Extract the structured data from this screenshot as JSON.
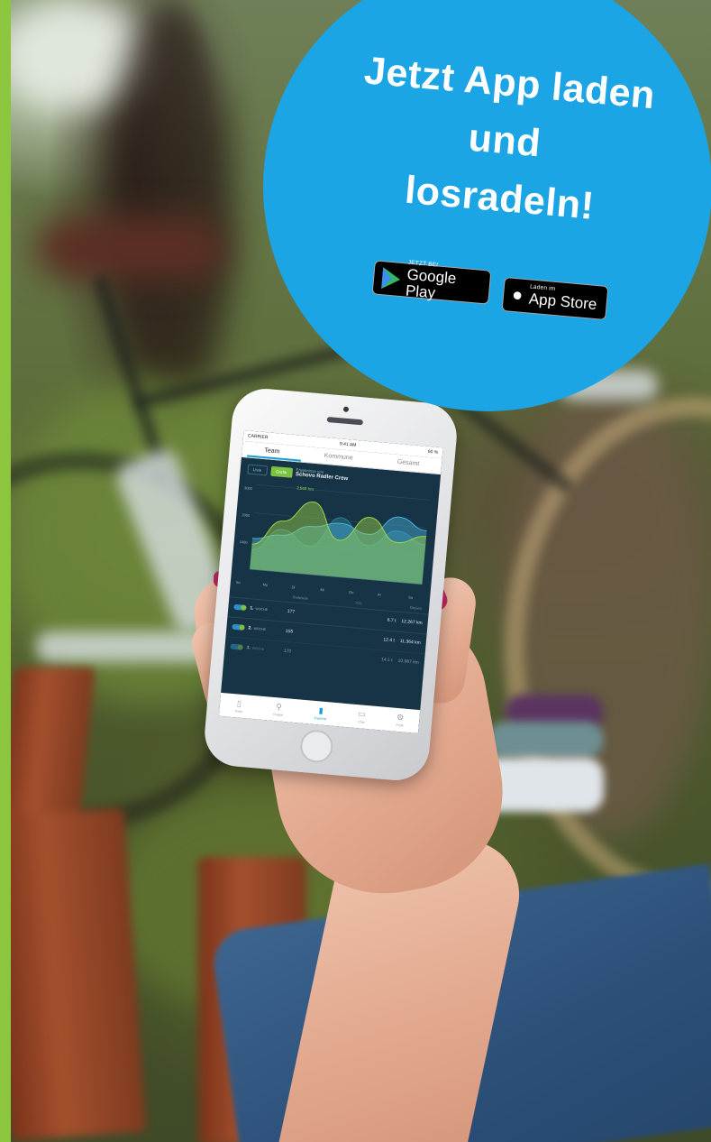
{
  "promo": {
    "headline_line1": "Jetzt App laden",
    "headline_line2": "und",
    "headline_line3": "losradeln!",
    "circle_color": "#1ba5e5",
    "stores": [
      {
        "small": "JETZT BEI",
        "big": "Google Play",
        "icon": "google-play-icon"
      },
      {
        "small": "Laden im",
        "big": "App Store",
        "icon": "apple-icon"
      }
    ]
  },
  "accent_strip_color": "#8cc63f",
  "phone": {
    "status": {
      "carrier": "CARRIER",
      "time": "9:41 AM",
      "battery": "60 %"
    },
    "tabs": [
      "Team",
      "Kommune",
      "Gesamt"
    ],
    "active_tab": "Team",
    "toggle": {
      "list": "Liste",
      "graph": "Grafik"
    },
    "results_caption": "Ergebnisse von",
    "team_name": "Schovo Radler Crew",
    "chart_data": {
      "type": "area",
      "y_unit": "km",
      "ticks_y": [
        "3000",
        "2000",
        "1000"
      ],
      "peak_label": "2.568 km",
      "categories": [
        "So",
        "Mo",
        "Di",
        "Mi",
        "Do",
        "Fr",
        "Sa"
      ],
      "series": [
        {
          "values": [
            900,
            1800,
            2568,
            1300,
            2200,
            1400,
            1700
          ]
        },
        {
          "values": [
            1100,
            1300,
            1700,
            1900,
            1600,
            2300,
            1900
          ]
        },
        {
          "values": [
            700,
            1500,
            1000,
            2100,
            1200,
            1800,
            1400
          ]
        }
      ],
      "ylim": [
        0,
        3000
      ],
      "colors": [
        "#9fd545",
        "#48b1dc",
        "#2f7f93"
      ]
    },
    "list_header": {
      "col1": "Radelnde",
      "col2": "CO₂",
      "col3": "Distanz"
    },
    "rows": [
      {
        "rank": "1.",
        "week": "WOCHE",
        "count": "177",
        "co2": "6.7 t",
        "dist": "12.267 km"
      },
      {
        "rank": "2.",
        "week": "WOCHE",
        "count": "155",
        "co2": "12.4 t",
        "dist": "11.364 km"
      },
      {
        "rank": "3.",
        "week": "WOCHE",
        "count": "170",
        "co2": "14.1 t",
        "dist": "10.987 km"
      }
    ],
    "nav": [
      {
        "label": "Karte",
        "icon": "map-icon"
      },
      {
        "label": "Radeln",
        "icon": "bike-icon"
      },
      {
        "label": "Ergebnis",
        "icon": "chart-icon"
      },
      {
        "label": "Chat",
        "icon": "chat-icon"
      },
      {
        "label": "Profil",
        "icon": "gear-icon"
      }
    ],
    "active_nav": "Ergebnis"
  }
}
